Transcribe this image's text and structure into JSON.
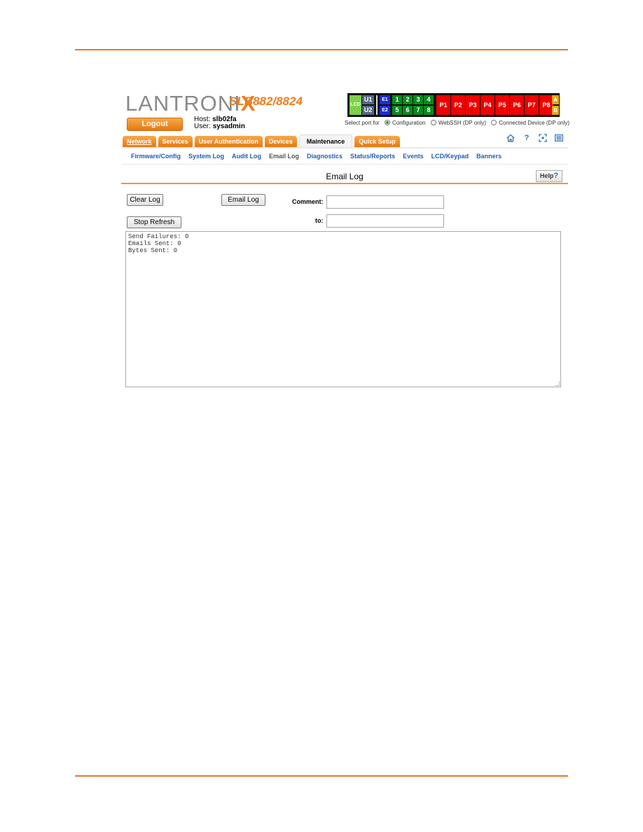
{
  "brand": {
    "logo": "LANTRONI",
    "logo_x": "X",
    "registered": "®",
    "model": "SLB882/8824"
  },
  "header": {
    "logout_label": "Logout",
    "host_label": "Host:",
    "host_value": "slb02fa",
    "user_label": "User:",
    "user_value": "sysadmin"
  },
  "ports": {
    "lcd": "LCD",
    "u1": "U1",
    "u2": "U2",
    "e1": "E1",
    "e2": "E2",
    "numbers_top": [
      "1",
      "2",
      "3",
      "4"
    ],
    "numbers_bottom": [
      "5",
      "6",
      "7",
      "8"
    ],
    "p": [
      "P1",
      "P2",
      "P3",
      "P4",
      "P5",
      "P6",
      "P7",
      "P8"
    ],
    "a": "A",
    "b": "B",
    "colors": {
      "lcd": "#7ed04b",
      "u": "#556880",
      "e": "#1d2cd6",
      "n": "#0a8a1e",
      "p": "#f00000",
      "ab": "#e6a612"
    },
    "select_label": "Select port for",
    "options": [
      {
        "label": "Configuration",
        "selected": true
      },
      {
        "label": "WebSSH (DP only)",
        "selected": false
      },
      {
        "label": "Connected Device (DP only)",
        "selected": false
      }
    ]
  },
  "tabs": [
    {
      "label": "Network"
    },
    {
      "label": "Services"
    },
    {
      "label": "User Authentication"
    },
    {
      "label": "Devices"
    },
    {
      "label": "Maintenance",
      "active": true
    },
    {
      "label": "Quick Setup"
    }
  ],
  "toolbar_icons": [
    "home-icon",
    "help-icon",
    "network-icon",
    "list-icon"
  ],
  "subnav": [
    {
      "label": "Firmware/Config"
    },
    {
      "label": "System Log"
    },
    {
      "label": "Audit Log"
    },
    {
      "label": "Email Log",
      "current": true
    },
    {
      "label": "Diagnostics"
    },
    {
      "label": "Status/Reports"
    },
    {
      "label": "Events"
    },
    {
      "label": "LCD/Keypad"
    },
    {
      "label": "Banners"
    }
  ],
  "page": {
    "title": "Email Log",
    "help_label": "Help",
    "clear_label": "Clear Log",
    "email_label": "Email Log",
    "stop_label": "Stop Refresh",
    "comment_label": "Comment:",
    "comment_value": "",
    "to_label": "to:",
    "to_value": "",
    "log_text": "Send Failures: 0\nEmails Sent: 0\nBytes Sent: 0"
  },
  "accent": "#e8782a"
}
